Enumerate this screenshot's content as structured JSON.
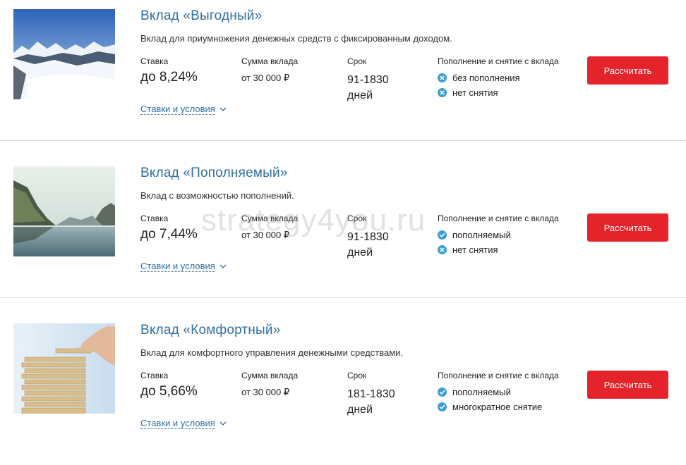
{
  "colors": {
    "title": "#2f6fa5",
    "button": "#e4232b",
    "icon": "#3a9ed6",
    "divider": "#e2e2e2"
  },
  "labels": {
    "rate": "Ставка",
    "amount": "Сумма вклада",
    "term": "Срок",
    "features": "Пополнение и снятие с вклада"
  },
  "deposits": [
    {
      "title": "Вклад «Выгодный»",
      "description": "Вклад для приумножения денежных средств с фиксированным доходом.",
      "rate": "до 8,24%",
      "amount": "от 30 000 ₽",
      "term_range": "91-1830",
      "term_unit": "дней",
      "features": [
        {
          "text": "без пополнения",
          "icon": "cross-icon"
        },
        {
          "text": "нет снятия",
          "icon": "cross-icon"
        }
      ],
      "button": "Рассчитать",
      "link": "Ставки и условия",
      "image": "snowy-mountains"
    },
    {
      "title": "Вклад «Пополняемый»",
      "description": "Вклад с возможностью пополнений.",
      "rate": "до 7,44%",
      "amount": "от 30 000 ₽",
      "term_range": "91-1830",
      "term_unit": "дней",
      "features": [
        {
          "text": "пополняемый",
          "icon": "check-icon"
        },
        {
          "text": "нет снятия",
          "icon": "cross-icon"
        }
      ],
      "button": "Рассчитать",
      "link": "Ставки и условия",
      "image": "mountain-lake"
    },
    {
      "title": "Вклад «Комфортный»",
      "description": "Вклад для комфортного управления денежными средствами.",
      "rate": "до 5,66%",
      "amount": "от 30 000 ₽",
      "term_range": "181-1830",
      "term_unit": "дней",
      "features": [
        {
          "text": "пополняемый",
          "icon": "check-icon"
        },
        {
          "text": "многократное снятие",
          "icon": "check-icon"
        }
      ],
      "button": "Рассчитать",
      "link": "Ставки и условия",
      "image": "wooden-blocks-tower"
    }
  ],
  "watermark": "strategy4you.ru"
}
